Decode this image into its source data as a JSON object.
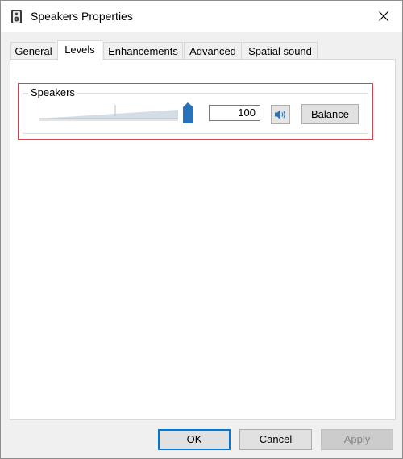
{
  "window": {
    "title": "Speakers Properties",
    "icon": "speaker-icon",
    "close_icon": "close-icon"
  },
  "tabs": [
    {
      "label": "General",
      "active": false
    },
    {
      "label": "Levels",
      "active": true
    },
    {
      "label": "Enhancements",
      "active": false
    },
    {
      "label": "Advanced",
      "active": false
    },
    {
      "label": "Spatial sound",
      "active": false
    }
  ],
  "levels": {
    "group_label": "Speakers",
    "volume_value": "100",
    "volume_fraction": 1.0,
    "mute_icon": "volume-icon",
    "balance_label": "Balance"
  },
  "buttons": {
    "ok": "OK",
    "cancel": "Cancel",
    "apply_first": "A",
    "apply_rest": "pply"
  },
  "colors": {
    "accent": "#0078d7",
    "slider_thumb": "#2a72b8",
    "highlight": "#d8404a"
  }
}
